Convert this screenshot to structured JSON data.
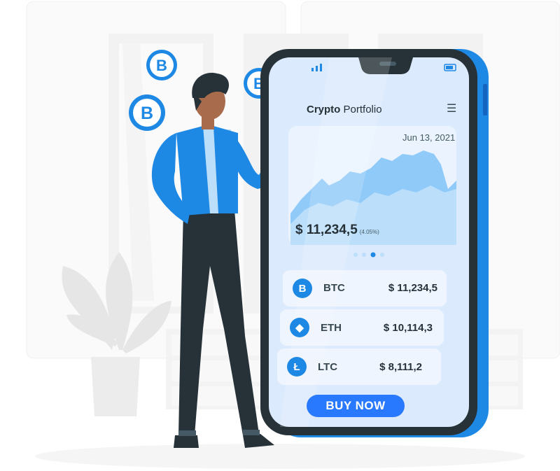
{
  "app": {
    "title_bold": "Crypto",
    "title_light": "Portfolio",
    "menu_icon": "hamburger-menu-icon"
  },
  "status_bar": {
    "signal_icon": "signal-bars-icon",
    "battery_icon": "battery-icon"
  },
  "chart_card": {
    "date": "Jun 13, 2021",
    "total": "$ 11,234,5",
    "change": "(4.05%)",
    "carousel_dots": 4,
    "active_dot": 3
  },
  "coins": [
    {
      "symbol": "BTC",
      "value": "$ 11,234,5",
      "icon": "bitcoin-icon",
      "glyph": "B"
    },
    {
      "symbol": "ETH",
      "value": "$ 10,114,3",
      "icon": "ethereum-icon",
      "glyph": "◆"
    },
    {
      "symbol": "LTC",
      "value": "$ 8,111,2",
      "icon": "litecoin-icon",
      "glyph": "Ł"
    }
  ],
  "buy_button": {
    "label": "BUY NOW"
  },
  "colors": {
    "accent": "#2979ff",
    "screen": "#dbeafc",
    "jacket": "#1e88e5",
    "pants": "#263238",
    "skin": "#a86b4c"
  }
}
